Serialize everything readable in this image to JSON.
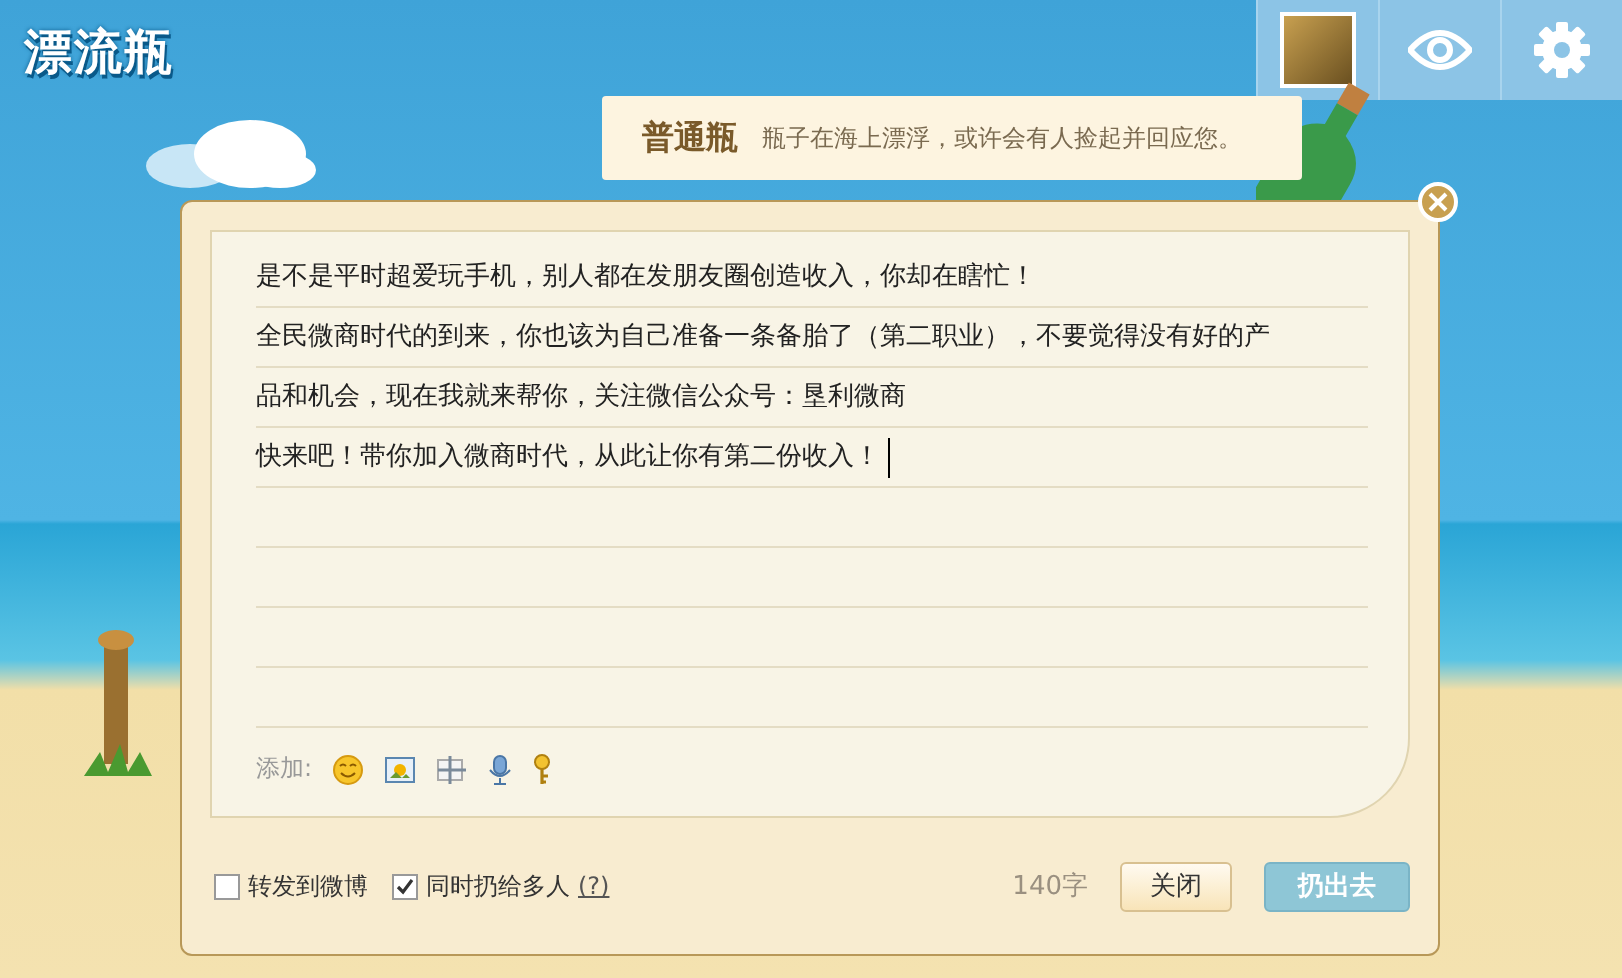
{
  "logo": "漂流瓶",
  "toolbar": [
    {
      "kind": "avatar"
    },
    {
      "kind": "eye"
    },
    {
      "kind": "gear"
    }
  ],
  "bottle_info": {
    "type": "普通瓶",
    "description": "瓶子在海上漂浮，或许会有人捡起并回应您。"
  },
  "message_lines": [
    "是不是平时超爱玩手机，别人都在发朋友圈创造收入，你却在瞎忙！",
    "全民微商时代的到来，你也该为自己准备一条备胎了（第二职业），不要觉得没有好的产",
    "品和机会，现在我就来帮你，关注微信公众号：垦利微商",
    "快来吧！带你加入微商时代，从此让你有第二份收入！"
  ],
  "attach": {
    "label": "添加:",
    "tools": [
      {
        "kind": "emoji"
      },
      {
        "kind": "image"
      },
      {
        "kind": "screenshot"
      },
      {
        "kind": "voice"
      },
      {
        "kind": "key"
      }
    ]
  },
  "options": [
    {
      "label": "转发到微博",
      "checked": false
    },
    {
      "label": "同时扔给多人",
      "checked": true,
      "help": "(?)"
    }
  ],
  "counter": "140字",
  "buttons": [
    {
      "label": "关闭",
      "kind": "secondary"
    },
    {
      "label": "扔出去",
      "kind": "primary"
    }
  ]
}
